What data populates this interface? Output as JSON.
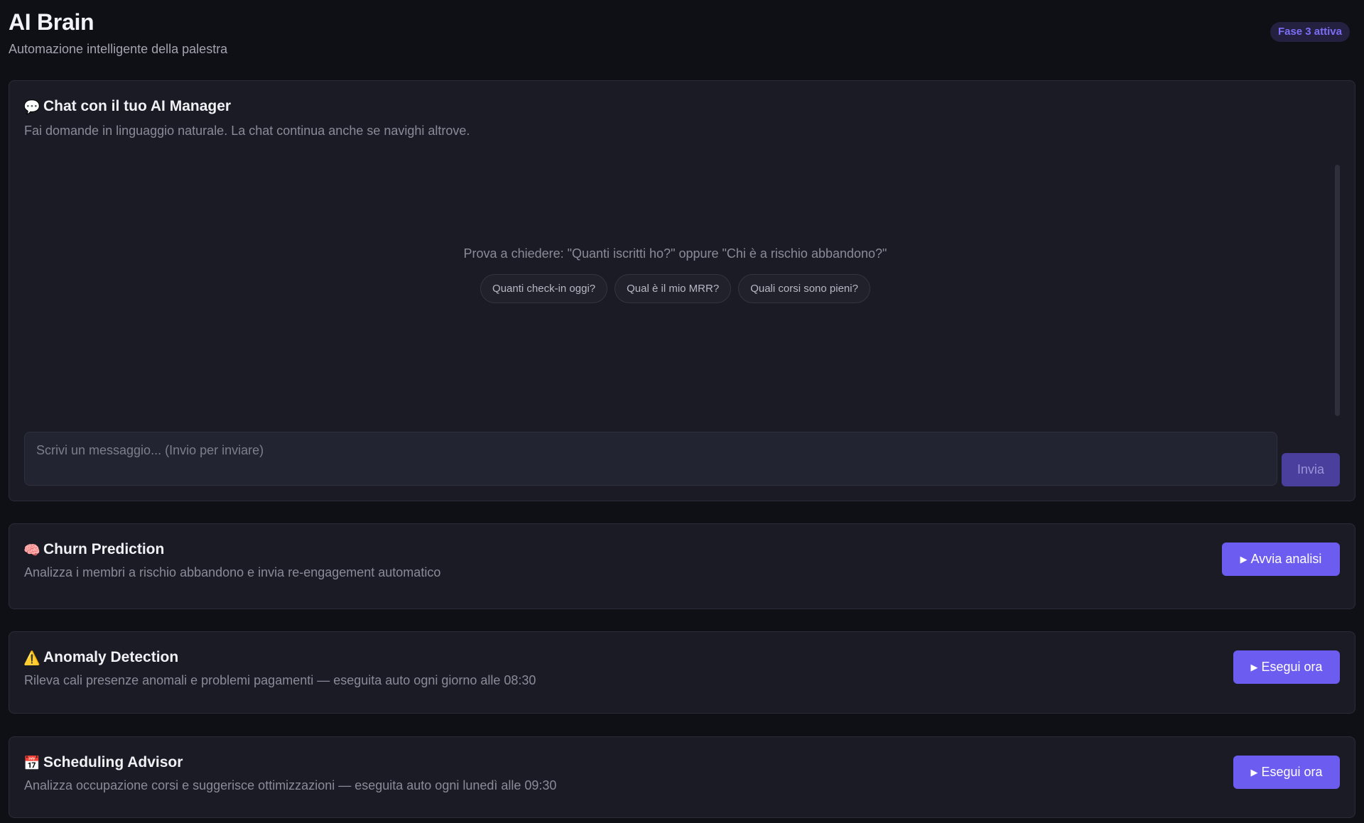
{
  "header": {
    "title": "AI Brain",
    "subtitle": "Automazione intelligente della palestra",
    "phase_badge": "Fase 3 attiva"
  },
  "chat": {
    "icon": "speech-bubble-icon",
    "icon_glyph": "💬",
    "title": "Chat con il tuo AI Manager",
    "description": "Fai domande in linguaggio naturale. La chat continua anche se navighi altrove.",
    "hint": "Prova a chiedere: \"Quanti iscritti ho?\" oppure \"Chi è a rischio abbandono?\"",
    "suggestions": [
      "Quanti check-in oggi?",
      "Qual è il mio MRR?",
      "Quali corsi sono pieni?"
    ],
    "input_placeholder": "Scrivi un messaggio... (Invio per inviare)",
    "send_label": "Invia"
  },
  "features": [
    {
      "icon": "brain-icon",
      "icon_glyph": "🧠",
      "title": "Churn Prediction",
      "description": "Analizza i membri a rischio abbandono e invia re-engagement automatico",
      "action_label": "Avvia analisi"
    },
    {
      "icon": "warning-icon",
      "icon_glyph": "⚠️",
      "title": "Anomaly Detection",
      "description": "Rileva cali presenze anomali e problemi pagamenti — eseguita auto ogni giorno alle 08:30",
      "action_label": "Esegui ora"
    },
    {
      "icon": "calendar-icon",
      "icon_glyph": "📅",
      "title": "Scheduling Advisor",
      "description": "Analizza occupazione corsi e suggerisce ottimizzazioni — eseguita auto ogni lunedì alle 09:30",
      "action_label": "Esegui ora"
    }
  ],
  "colors": {
    "background": "#0f1015",
    "card": "#1a1b25",
    "accent": "#6c5cf0",
    "badge_text": "#7c6ef6"
  }
}
